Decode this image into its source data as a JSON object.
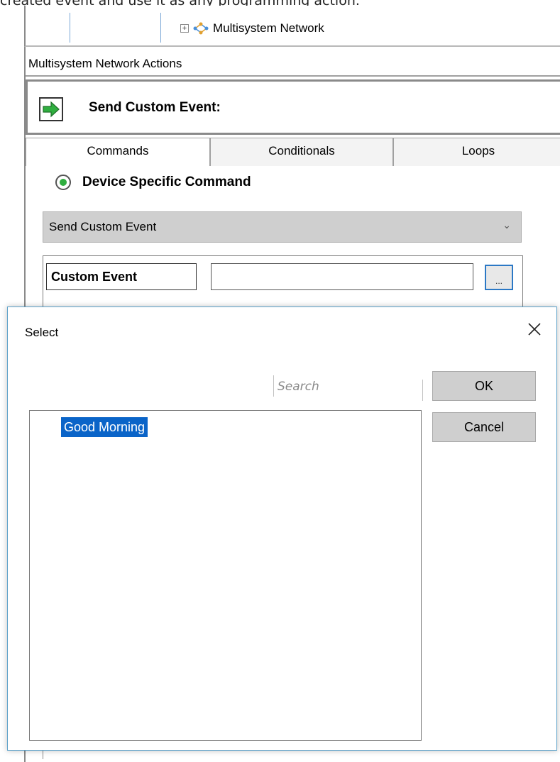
{
  "caption": "created event and use it as any programming action.",
  "tree": {
    "node_label": "Multisystem Network",
    "node_icon": "network-icon",
    "expand_glyph": "+"
  },
  "actions": {
    "header": "Multisystem Network Actions",
    "title": "Send Custom Event:",
    "icon": "green-arrow-icon"
  },
  "tabs": [
    {
      "label": "Commands"
    },
    {
      "label": "Conditionals"
    },
    {
      "label": "Loops"
    }
  ],
  "command": {
    "radio_label": "Device Specific Command",
    "selected": "Send Custom Event",
    "field_label": "Custom Event",
    "field_value": "",
    "browse_label": "..."
  },
  "dialog": {
    "title": "Select",
    "search_placeholder": "Search",
    "ok_label": "OK",
    "cancel_label": "Cancel",
    "items": [
      {
        "label": "Good Morning",
        "selected": true
      }
    ]
  },
  "colors": {
    "selection": "#0a64c8",
    "arrow": "#2fae3f",
    "dialog_border": "#5aa0c8",
    "focus_border": "#2b78c5"
  }
}
